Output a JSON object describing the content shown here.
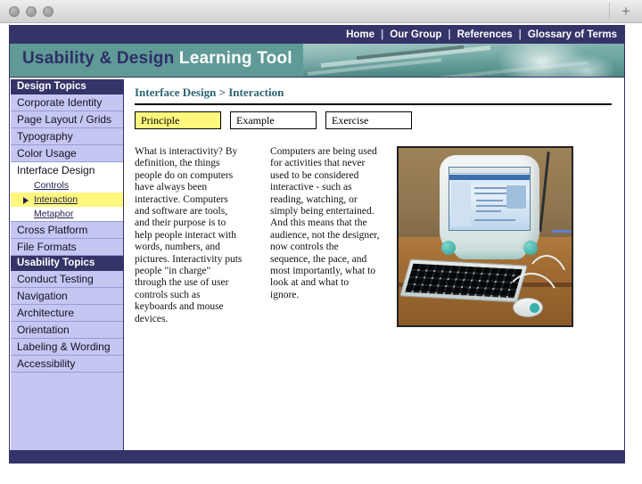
{
  "browser": {
    "traffic_lights": [
      "close",
      "minimize",
      "zoom"
    ],
    "new_tab_label": "+"
  },
  "topnav": {
    "separator": "|",
    "links": [
      {
        "label": "Home"
      },
      {
        "label": "Our Group"
      },
      {
        "label": "References"
      },
      {
        "label": "Glossary of Terms"
      }
    ]
  },
  "banner": {
    "title_part1": "Usability & Design",
    "title_part2": "Learning Tool",
    "photo_alt": "hands drafting on a desk with pen and ruler, teal tinted"
  },
  "sidebar": {
    "sections": [
      {
        "header": "Design Topics",
        "items": [
          {
            "label": "Corporate Identity",
            "type": "item"
          },
          {
            "label": "Page Layout / Grids",
            "type": "item"
          },
          {
            "label": "Typography",
            "type": "item"
          },
          {
            "label": "Color Usage",
            "type": "item"
          },
          {
            "label": "Interface Design",
            "type": "item",
            "state": "open"
          },
          {
            "label": "Controls",
            "type": "sub"
          },
          {
            "label": "Interaction",
            "type": "sub",
            "state": "active"
          },
          {
            "label": "Metaphor",
            "type": "sub"
          },
          {
            "label": "Cross Platform",
            "type": "item"
          },
          {
            "label": "File Formats",
            "type": "item"
          }
        ]
      },
      {
        "header": "Usability Topics",
        "items": [
          {
            "label": "Conduct Testing",
            "type": "item"
          },
          {
            "label": "Navigation",
            "type": "item"
          },
          {
            "label": "Architecture",
            "type": "item"
          },
          {
            "label": "Orientation",
            "type": "item"
          },
          {
            "label": "Labeling & Wording",
            "type": "item"
          },
          {
            "label": "Accessibility",
            "type": "item"
          }
        ]
      }
    ]
  },
  "content": {
    "breadcrumb": "Interface Design > Interaction",
    "tabs": [
      {
        "label": "Principle",
        "selected": true
      },
      {
        "label": "Example",
        "selected": false
      },
      {
        "label": "Exercise",
        "selected": false
      }
    ],
    "columns": [
      "What is interactivity? By definition, the things people do on computers have always been interactive. Computers and software are tools, and their purpose is to help people interact with words, numbers, and pictures. Interactivity puts people \"in charge\" through the use of user controls such as keyboards and mouse devices.",
      "Computers are being used for activities that never used to be considered interactive - such as reading, watching, or simply being entertained. And this means that the audience, not the designer, now controls the sequence, the pace, and most importantly, what to look at and what to ignore."
    ],
    "photo_alt": "teal iMac G3 computer with keyboard and mouse on a wooden desk"
  },
  "colors": {
    "navy": "#343469",
    "teal": "#5f9a96",
    "lavender": "#c6c6f2",
    "highlight_yellow": "#fff77e",
    "breadcrumb_teal": "#2c6372"
  }
}
